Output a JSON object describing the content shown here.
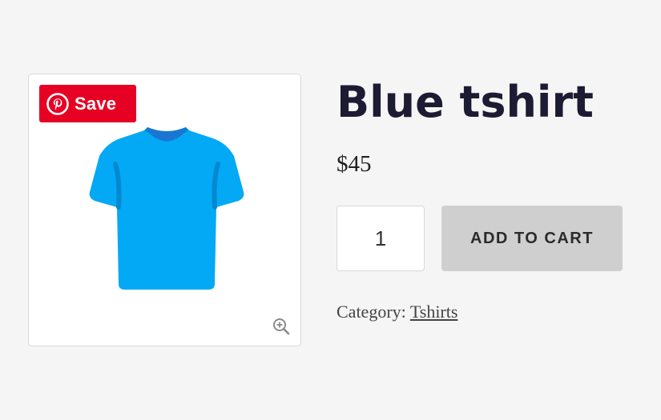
{
  "pinterest": {
    "save_label": "Save",
    "brand_color": "#e60023"
  },
  "product": {
    "title": "Blue tshirt",
    "price": "$45",
    "image_icon": "tshirt-icon",
    "image_color": "#03a9f4",
    "zoom_icon": "zoom-in-icon"
  },
  "cart": {
    "quantity": "1",
    "add_label": "ADD TO CART"
  },
  "meta": {
    "category_label": "Category: ",
    "category_link": "Tshirts"
  }
}
